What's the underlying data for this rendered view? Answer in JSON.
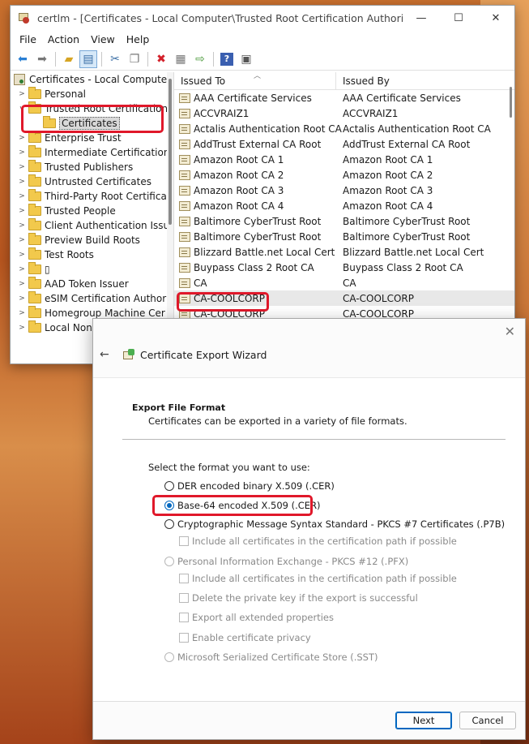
{
  "window": {
    "title": "certlm - [Certificates - Local Computer\\Trusted Root Certification Authorities\\Certific...",
    "minimize": "—",
    "maximize": "☐",
    "close": "✕"
  },
  "menu": [
    "File",
    "Action",
    "View",
    "Help"
  ],
  "toolbar_icons": [
    "back-arrow-icon",
    "forward-arrow-icon",
    "up-folder-icon",
    "show-hide-tree-icon",
    "cut-icon",
    "copy-icon",
    "delete-icon",
    "properties-icon",
    "export-list-icon",
    "help-icon",
    "action-pane-icon"
  ],
  "tree": {
    "root": "Certificates - Local Computer",
    "items": [
      "Personal",
      "Trusted Root Certification",
      "Certificates",
      "Enterprise Trust",
      "Intermediate Certification",
      "Trusted Publishers",
      "Untrusted Certificates",
      "Third-Party Root Certificat",
      "Trusted People",
      "Client Authentication Issu",
      "Preview Build Roots",
      "Test Roots",
      "▯",
      "AAD Token Issuer",
      "eSIM Certification Authori",
      "Homegroup Machine Cer",
      "Local NonR"
    ]
  },
  "list": {
    "col_issued_to": "Issued To",
    "col_issued_by": "Issued By",
    "rows": [
      [
        "AAA Certificate Services",
        "AAA Certificate Services"
      ],
      [
        "ACCVRAIZ1",
        "ACCVRAIZ1"
      ],
      [
        "Actalis Authentication Root CA",
        "Actalis Authentication Root CA"
      ],
      [
        "AddTrust External CA Root",
        "AddTrust External CA Root"
      ],
      [
        "Amazon Root CA 1",
        "Amazon Root CA 1"
      ],
      [
        "Amazon Root CA 2",
        "Amazon Root CA 2"
      ],
      [
        "Amazon Root CA 3",
        "Amazon Root CA 3"
      ],
      [
        "Amazon Root CA 4",
        "Amazon Root CA 4"
      ],
      [
        "Baltimore CyberTrust Root",
        "Baltimore CyberTrust Root"
      ],
      [
        "Baltimore CyberTrust Root",
        "Baltimore CyberTrust Root"
      ],
      [
        "Blizzard Battle.net Local Cert",
        "Blizzard Battle.net Local Cert"
      ],
      [
        "Buypass Class 2 Root CA",
        "Buypass Class 2 Root CA"
      ],
      [
        "CA",
        "CA"
      ],
      [
        "CA-COOLCORP",
        "CA-COOLCORP"
      ],
      [
        "CA-COOLCORP",
        "CA-COOLCORP"
      ]
    ]
  },
  "wizard": {
    "close": "✕",
    "back": "←",
    "title": "Certificate Export Wizard",
    "heading": "Export File Format",
    "subheading": "Certificates can be exported in a variety of file formats.",
    "prompt": "Select the format you want to use:",
    "opt_der": "DER encoded binary X.509 (.CER)",
    "opt_b64": "Base-64 encoded X.509 (.CER)",
    "opt_p7b": "Cryptographic Message Syntax Standard - PKCS #7 Certificates (.P7B)",
    "chk_p7b_path": "Include all certificates in the certification path if possible",
    "opt_pfx": "Personal Information Exchange - PKCS #12 (.PFX)",
    "chk_pfx_path": "Include all certificates in the certification path if possible",
    "chk_pfx_delete": "Delete the private key if the export is successful",
    "chk_pfx_ext": "Export all extended properties",
    "chk_pfx_privacy": "Enable certificate privacy",
    "opt_sst": "Microsoft Serialized Certificate Store (.SST)",
    "next": "Next",
    "cancel": "Cancel"
  },
  "colors": {
    "highlight_red": "#e0182a",
    "accent_blue": "#0067c0"
  }
}
